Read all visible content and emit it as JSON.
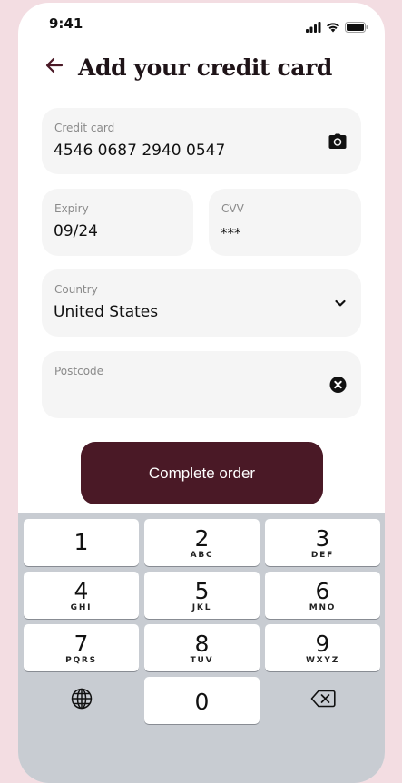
{
  "status_bar": {
    "time": "9:41"
  },
  "header": {
    "title": "Add your credit card"
  },
  "form": {
    "credit_card": {
      "label": "Credit card",
      "value": "4546 0687 2940 0547"
    },
    "expiry": {
      "label": "Expiry",
      "value": "09/24"
    },
    "cvv": {
      "label": "CVV",
      "value": "***"
    },
    "country": {
      "label": "Country",
      "value": "United States"
    },
    "postcode": {
      "label": "Postcode",
      "value": ""
    }
  },
  "cta": {
    "label": "Complete order"
  },
  "keyboard": {
    "keys": [
      {
        "num": "1",
        "letters": ""
      },
      {
        "num": "2",
        "letters": "ABC"
      },
      {
        "num": "3",
        "letters": "DEF"
      },
      {
        "num": "4",
        "letters": "GHI"
      },
      {
        "num": "5",
        "letters": "JKL"
      },
      {
        "num": "6",
        "letters": "MNO"
      },
      {
        "num": "7",
        "letters": "PQRS"
      },
      {
        "num": "8",
        "letters": "TUV"
      },
      {
        "num": "9",
        "letters": "WXYZ"
      },
      {
        "num": "0",
        "letters": ""
      }
    ]
  },
  "colors": {
    "accent": "#4a1926",
    "background": "#f3dde2",
    "field_bg": "#f5f5f5",
    "keyboard_bg": "#c8ccd2"
  },
  "icons": [
    "signal-icon",
    "wifi-icon",
    "battery-icon",
    "back-arrow-icon",
    "camera-icon",
    "chevron-down-icon",
    "clear-icon",
    "globe-icon",
    "backspace-icon"
  ]
}
